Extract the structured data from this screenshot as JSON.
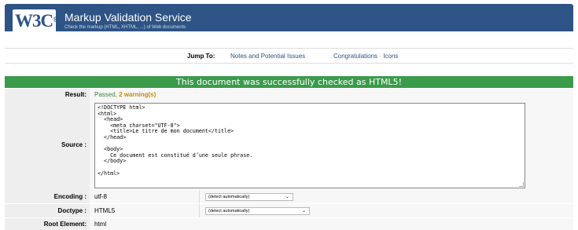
{
  "banner": {
    "logo": "W3C",
    "logo_sup": "®",
    "title": "Markup Validation Service",
    "subtitle": "Check the markup (HTML, XHTML, ...) of Web documents"
  },
  "jumpbar": {
    "label": "Jump To:",
    "links": [
      "Notes and Potential Issues",
      "Congratulations",
      "Icons"
    ],
    "separator": "·"
  },
  "result_header": "This document was successfully checked as HTML5!",
  "rows": {
    "result": {
      "label": "Result:",
      "passed": "Passed,",
      "warnings": "2 warning(s)"
    },
    "source": {
      "label": "Source :",
      "code": "<!DOCTYPE html>\n<html>\n  <head>\n    <meta charset=\"UTF-8\">\n    <title>Le titre de mon document</title>\n  </head>\n\n  <body>\n    Ce document est constitué d’une seule phrase.\n  </body>\n\n</html>"
    },
    "encoding": {
      "label": "Encoding :",
      "value": "utf-8",
      "select": "(detect automatically)"
    },
    "doctype": {
      "label": "Doctype :",
      "value": "HTML5",
      "select": "(detect automatically)"
    },
    "root": {
      "label": "Root Element:",
      "value": "html"
    }
  },
  "colors": {
    "banner": "#2e5385",
    "success": "#3a9b4a",
    "warning": "#c48a00",
    "link": "#2e5385"
  },
  "icons": [
    "w3c-logo",
    "chevron-down-icon",
    "resize-grip-icon"
  ]
}
